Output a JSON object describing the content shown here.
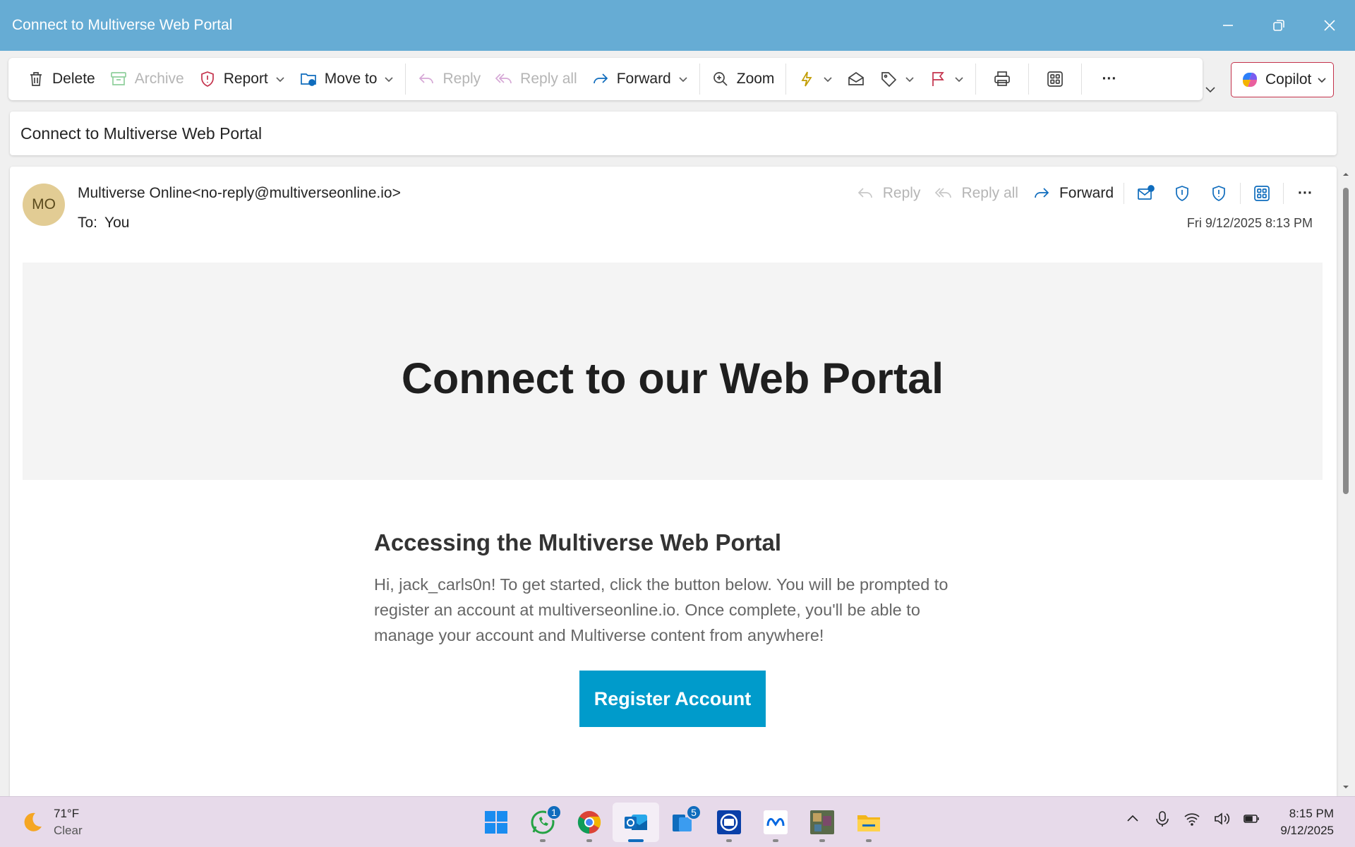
{
  "window": {
    "title": "Connect to Multiverse Web Portal"
  },
  "toolbar": {
    "delete_label": "Delete",
    "archive_label": "Archive",
    "report_label": "Report",
    "move_to_label": "Move to",
    "reply_label": "Reply",
    "reply_all_label": "Reply all",
    "forward_label": "Forward",
    "zoom_label": "Zoom",
    "more_label": "···",
    "copilot_label": "Copilot"
  },
  "message": {
    "subject": "Connect to Multiverse Web Portal",
    "avatar_initials": "MO",
    "sender": "Multiverse Online<no-reply@multiverseonline.io>",
    "to_label": "To:",
    "to_value": "You",
    "date": "Fri 9/12/2025 8:13 PM",
    "actions": {
      "reply_label": "Reply",
      "reply_all_label": "Reply all",
      "forward_label": "Forward",
      "more_label": "···"
    },
    "body": {
      "hero_title": "Connect to our Web Portal",
      "heading": "Accessing the Multiverse Web Portal",
      "paragraph": "Hi, jack_carls0n! To get started, click the button below. You will be prompted to register an account at multiverseonline.io. Once complete, you'll be able to manage your account and Multiverse content from anywhere!",
      "button_label": "Register Account"
    }
  },
  "taskbar": {
    "weather_temp": "71°F",
    "weather_condition": "Clear",
    "whatsapp_badge": "1",
    "phone_link_badge": "5",
    "time": "8:15 PM",
    "date": "9/12/2025"
  },
  "colors": {
    "titlebar": "#66acd4",
    "accent": "#0f6cbd",
    "register_button": "#009bcb",
    "avatar": "#e2cc94"
  }
}
